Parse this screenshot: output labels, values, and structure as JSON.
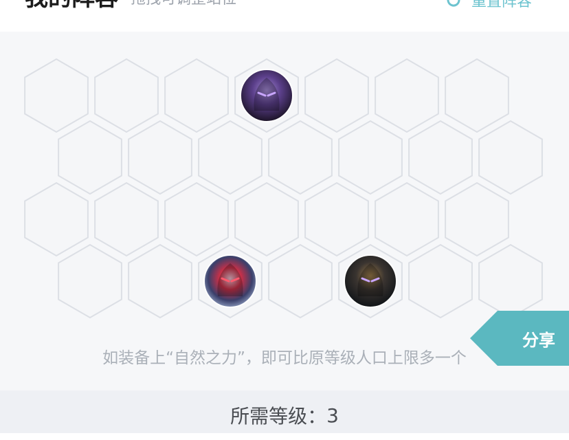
{
  "header": {
    "title": "我的阵容",
    "subtitle": "拖拽可调整站位",
    "reset_label": "重置阵容",
    "reset_icon": "refresh-icon"
  },
  "board": {
    "rows": 4,
    "cols": 7,
    "placed_champions": [
      {
        "row": 0,
        "col": 3,
        "portrait": "dark-armored-champion"
      },
      {
        "row": 3,
        "col": 2,
        "portrait": "red-mech-champion"
      },
      {
        "row": 3,
        "col": 4,
        "portrait": "gold-armored-champion"
      }
    ]
  },
  "share_label": "分享",
  "hint": "如装备上“自然之力”，即可比原等级人口上限多一个",
  "footer": {
    "level_label": "所需等级：",
    "level_value": "3"
  },
  "colors": {
    "accent": "#5bb8c0",
    "hex_stroke": "#dcdfe5",
    "board_bg": "#f6f7f9"
  }
}
